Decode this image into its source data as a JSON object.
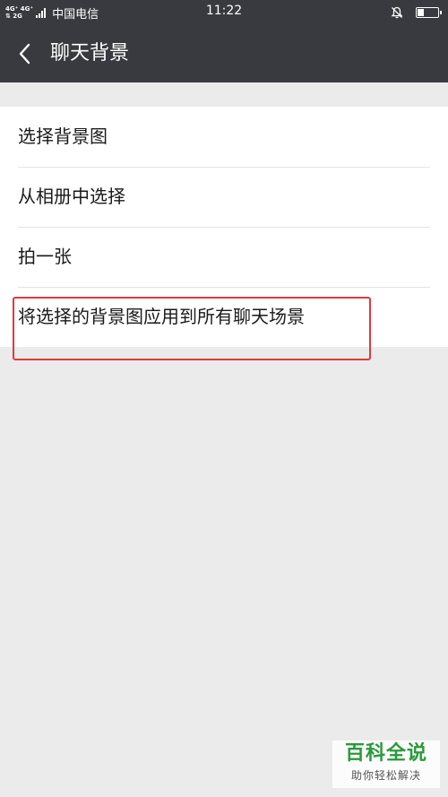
{
  "status_bar": {
    "network_top": "4G⁺ 4G⁺",
    "network_bottom": "⇅ 2G",
    "carrier": "中国电信",
    "time": "11:22",
    "battery_level": 0.35
  },
  "header": {
    "title": "聊天背景"
  },
  "menu": {
    "items": [
      {
        "label": "选择背景图"
      },
      {
        "label": "从相册中选择"
      },
      {
        "label": "拍一张"
      },
      {
        "label": "将选择的背景图应用到所有聊天场景"
      }
    ]
  },
  "watermark": {
    "title": "百科全说",
    "subtitle": "助你轻松解决"
  },
  "colors": {
    "header_bg": "#393a3f",
    "page_bg": "#ebebeb",
    "highlight": "#e0393f",
    "watermark_green": "#2a9a3a"
  },
  "icons": [
    "back-arrow-icon",
    "mute-bell-icon",
    "battery-icon",
    "signal-icon"
  ]
}
